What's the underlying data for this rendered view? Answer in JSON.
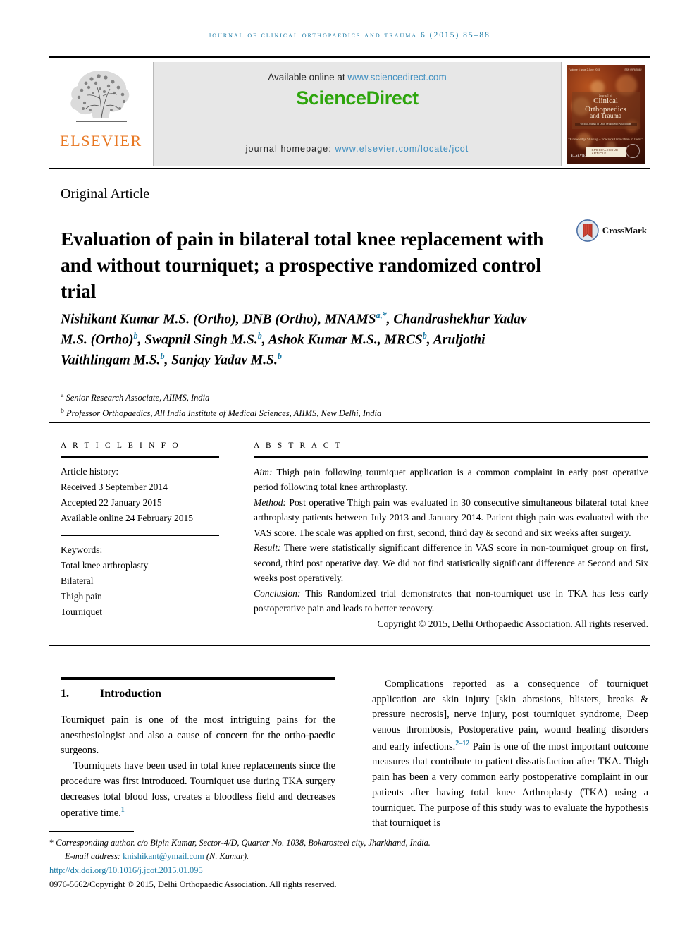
{
  "running_head": "Journal of clinical orthopaedics and trauma 6 (2015) 85–88",
  "masthead": {
    "elsevier_wordmark": "ELSEVIER",
    "available_online_prefix": "Available online at ",
    "available_online_url": "www.sciencedirect.com",
    "sciencedirect_logo": "ScienceDirect",
    "homepage_prefix": "journal homepage: ",
    "homepage_url": "www.elsevier.com/locate/jcot",
    "cover": {
      "volume_line_left": "Volume 6 Issue 2 June 2015",
      "volume_line_right": "ISSN 0976-5662",
      "kicker": "Journal of",
      "title_line1": "Clinical Orthopaedics",
      "title_line2": "and Trauma",
      "subtitle": "Official Journal of Delhi Orthopaedic Association",
      "tagline": "“Knowledge Sharing – Towards Innovation in India”",
      "publisher": "ELSEVIER",
      "button": "SPECIAL ISSUE ARTICLE"
    },
    "colors": {
      "link_blue": "#3f8fc0",
      "sciencedirect_green": "#2ea50d",
      "elsevier_orange": "#E87722",
      "banner_grey": "#e7e7e7"
    }
  },
  "article": {
    "type": "Original Article",
    "title": "Evaluation of pain in bilateral total knee replacement with and without tourniquet; a prospective randomized control trial",
    "crossmark_label": "CrossMark",
    "authors_html": "Nishikant Kumar M.S. (Ortho), DNB (Ortho), MNAMS<sup>a,*</sup>, Chandrashekhar Yadav M.S. (Ortho)<sup>b</sup>, Swapnil Singh M.S.<sup>b</sup>, Ashok Kumar M.S., MRCS<sup>b</sup>, Aruljothi Vaithlingam M.S.<sup>b</sup>, Sanjay Yadav M.S.<sup>b</sup>",
    "affiliations": [
      {
        "marker": "a",
        "text": "Senior Research Associate, AIIMS, India"
      },
      {
        "marker": "b",
        "text": "Professor Orthopaedics, All India Institute of Medical Sciences, AIIMS, New Delhi, India"
      }
    ]
  },
  "article_info": {
    "heading": "A R T I C L E  I N F O",
    "history_label": "Article history:",
    "received": "Received 3 September 2014",
    "accepted": "Accepted 22 January 2015",
    "available_online": "Available online 24 February 2015",
    "keywords_label": "Keywords:",
    "keywords": [
      "Total knee arthroplasty",
      "Bilateral",
      "Thigh pain",
      "Tourniquet"
    ]
  },
  "abstract": {
    "heading": "A B S T R A C T",
    "aim_label": "Aim:",
    "aim_text": " Thigh pain following tourniquet application is a common complaint in early post operative period following total knee arthroplasty.",
    "method_label": "Method:",
    "method_text": " Post operative Thigh pain was evaluated in 30 consecutive simultaneous bilateral total knee arthroplasty patients between July 2013 and January 2014. Patient thigh pain was evaluated with the VAS score. The scale was applied on first, second, third day & second and six weeks after surgery.",
    "result_label": "Result:",
    "result_text": " There were statistically significant difference in VAS score in non-tourniquet group on first, second, third post operative day. We did not find statistically significant difference at Second and Six weeks post operatively.",
    "conclusion_label": "Conclusion:",
    "conclusion_text": " This Randomized trial demonstrates that non-tourniquet use in TKA has less early postoperative pain and leads to better recovery.",
    "copyright": "Copyright © 2015, Delhi Orthopaedic Association. All rights reserved."
  },
  "body": {
    "section_number": "1.",
    "section_title": "Introduction",
    "left_paragraphs": [
      "Tourniquet pain is one of the most intriguing pains for the anesthesiologist and also a cause of concern for the ortho-paedic surgeons.",
      "Tourniquets have been used in total knee replacements since the procedure was first introduced. Tourniquet use during TKA surgery decreases total blood loss, creates a bloodless field and decreases operative time."
    ],
    "left_paragraph2_ref": "1",
    "right_paragraph_part1": "Complications reported as a consequence of tourniquet application are skin injury [skin abrasions, blisters, breaks & pressure necrosis], nerve injury, post tourniquet syndrome, Deep venous thrombosis, Postoperative pain, wound healing disorders and early infections.",
    "right_paragraph_ref": "2–12",
    "right_paragraph_part2": " Pain is one of the most important outcome measures that contribute to patient dissatisfaction after TKA. Thigh pain has been a very common early postoperative complaint in our patients after having total knee Arthroplasty (TKA) using a tourniquet. The purpose of this study was to evaluate the hypothesis that tourniquet is"
  },
  "footer": {
    "corresponding_star": "*",
    "corresponding_text": " Corresponding author. c/o Bipin Kumar, Sector-4/D, Quarter No. 1038, Bokarosteel city, Jharkhand, India.",
    "email_label": "E-mail address: ",
    "email": "knishikant@ymail.com",
    "email_suffix": " (N. Kumar).",
    "doi": "http://dx.doi.org/10.1016/j.jcot.2015.01.095",
    "issn_copyright": "0976-5662/Copyright © 2015, Delhi Orthopaedic Association. All rights reserved."
  }
}
